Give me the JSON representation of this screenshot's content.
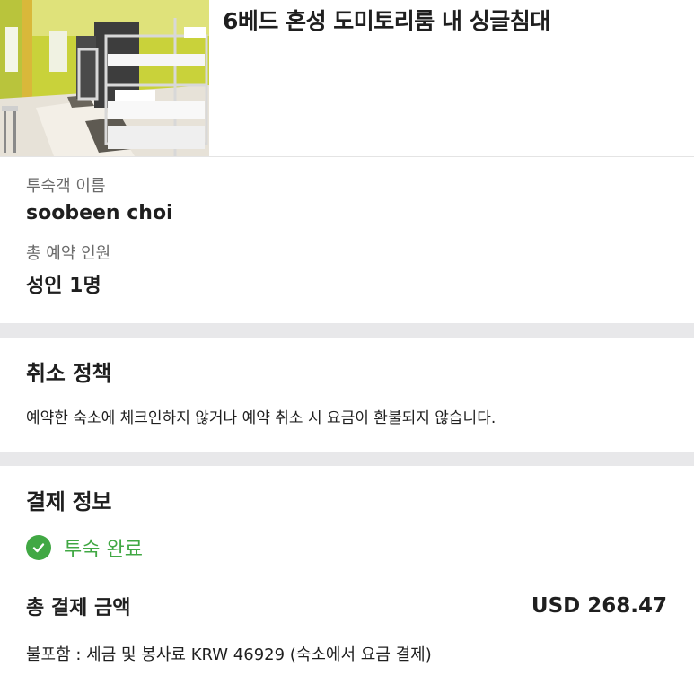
{
  "room": {
    "title": "6베드 혼성 도미토리룸 내 싱글침대",
    "photo": "dormitory-bunk-beds-photo"
  },
  "guest": {
    "name_label": "투숙객 이름",
    "name_value": "soobeen choi",
    "count_label": "총 예약 인원",
    "count_value": "성인 1명"
  },
  "policy": {
    "title": "취소 정책",
    "text": "예약한 숙소에 체크인하지 않거나 예약 취소 시 요금이 환불되지 않습니다."
  },
  "payment": {
    "title": "결제 정보",
    "status_icon": "check-circle-icon",
    "status_text": "투숙 완료",
    "status_color": "#41a844",
    "total_label": "총 결제 금액",
    "total_amount": "USD 268.47",
    "excluded_note": "불포함 : 세금 및 봉사료 KRW 46929 (숙소에서 요금 결제)"
  }
}
